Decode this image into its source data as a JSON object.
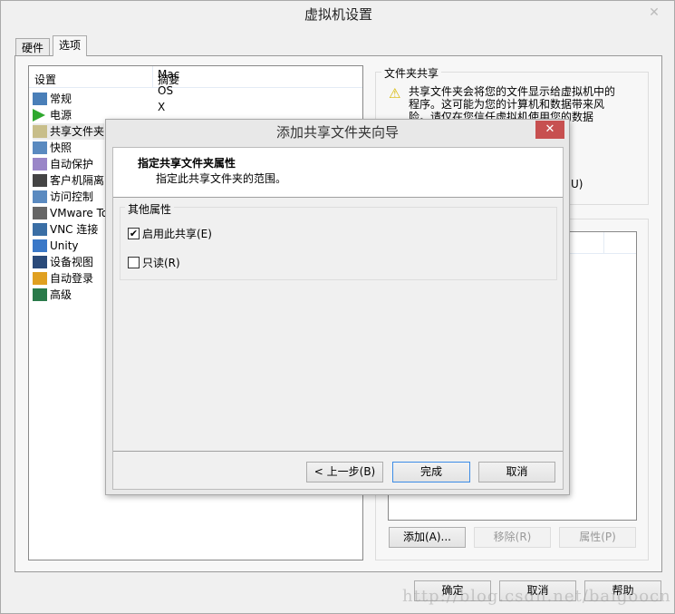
{
  "window": {
    "title": "虚拟机设置",
    "close": "✕"
  },
  "tabs": [
    {
      "label": "硬件"
    },
    {
      "label": "选项"
    }
  ],
  "settings_list": {
    "headers": [
      "设置",
      "摘要"
    ],
    "items": [
      {
        "label": "常规",
        "summary": "Mac OS X 10.9",
        "icon": "monitor-icon"
      },
      {
        "label": "电源",
        "summary": "",
        "icon": "play-icon"
      },
      {
        "label": "共享文件夹",
        "summary": "",
        "icon": "folder-icon"
      },
      {
        "label": "快照",
        "summary": "",
        "icon": "snapshot-icon"
      },
      {
        "label": "自动保护",
        "summary": "",
        "icon": "autoprotect-icon"
      },
      {
        "label": "客户机隔离",
        "summary": "",
        "icon": "lock-icon"
      },
      {
        "label": "访问控制",
        "summary": "",
        "icon": "access-control-icon"
      },
      {
        "label": "VMware To",
        "summary": "",
        "icon": "vmware-icon"
      },
      {
        "label": "VNC 连接",
        "summary": "",
        "icon": "vnc-icon"
      },
      {
        "label": "Unity",
        "summary": "",
        "icon": "unity-icon"
      },
      {
        "label": "设备视图",
        "summary": "",
        "icon": "device-view-icon"
      },
      {
        "label": "自动登录",
        "summary": "",
        "icon": "autologin-icon"
      },
      {
        "label": "高级",
        "summary": "",
        "icon": "advanced-icon"
      }
    ]
  },
  "folder_sharing": {
    "title": "文件夹共享",
    "warning": "共享文件夹会将您的文件显示给虚拟机中的程序。这可能为您的计算机和数据带来风险。请仅在您信任虚拟机使用您的数据",
    "partial": "U)"
  },
  "folder_buttons": {
    "add": "添加(A)...",
    "remove": "移除(R)",
    "properties": "属性(P)"
  },
  "footer": {
    "ok": "确定",
    "cancel": "取消",
    "help": "帮助"
  },
  "watermark": "http://blog.csdn.net/baigoocn",
  "dialog": {
    "title": "添加共享文件夹向导",
    "close": "✕",
    "heading": "指定共享文件夹属性",
    "subheading": "指定此共享文件夹的范围。",
    "group": "其他属性",
    "options": [
      {
        "label": "启用此共享(E)",
        "checked": true
      },
      {
        "label": "只读(R)",
        "checked": false
      }
    ],
    "back": "< 上一步(B)",
    "finish": "完成",
    "cancel": "取消"
  },
  "colors": {
    "close_red": "#c75050",
    "accent": "#3c8ce6"
  }
}
